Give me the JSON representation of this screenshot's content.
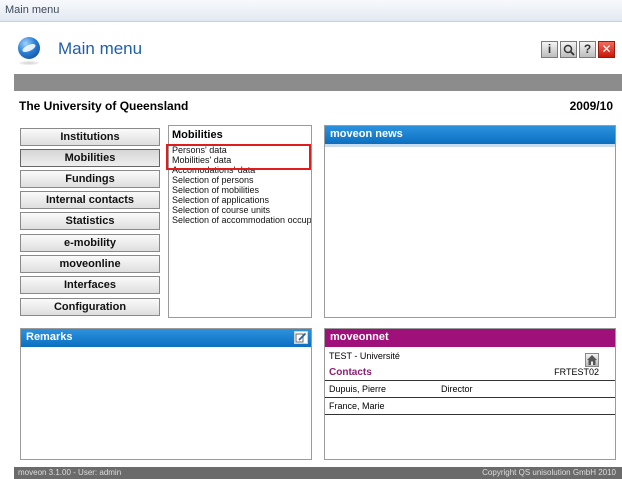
{
  "window": {
    "title": "Main menu"
  },
  "header": {
    "title": "Main menu"
  },
  "toolbar": {
    "info_label": "i",
    "help_label": "?",
    "close_label": "✕"
  },
  "org": {
    "name": "The University of Queensland",
    "year": "2009/10"
  },
  "nav": [
    {
      "label": "Institutions"
    },
    {
      "label": "Mobilities"
    },
    {
      "label": "Fundings"
    },
    {
      "label": "Internal contacts"
    },
    {
      "label": "Statistics"
    },
    {
      "label": "e-mobility"
    },
    {
      "label": "moveonline"
    },
    {
      "label": "Interfaces"
    },
    {
      "label": "Configuration"
    }
  ],
  "mobilities": {
    "title": "Mobilities",
    "items": [
      "Persons' data",
      "Mobilities' data",
      "Accomodations' data",
      "Selection of persons",
      "Selection of mobilities",
      "Selection of applications",
      "Selection of course units",
      "Selection of accommodation occupancy"
    ]
  },
  "news": {
    "title": "moveon news"
  },
  "remarks": {
    "title": "Remarks"
  },
  "moveonnet": {
    "title": "moveonnet",
    "institution": "TEST - Université",
    "contacts_label": "Contacts",
    "code": "FRTEST02",
    "contacts": [
      {
        "name": "Dupuis, Pierre",
        "role": "Director"
      },
      {
        "name": "France, Marie",
        "role": ""
      }
    ]
  },
  "status": {
    "left": "moveon 3.1.00 - User: admin",
    "right": "Copyright QS unisolution GmbH 2010"
  },
  "colors": {
    "header_title": "#1f5fa8",
    "panel_blue": "#0b6fc1",
    "panel_purple": "#a0107a",
    "highlight": "#e01d1d",
    "contacts_text": "#8a1f73"
  }
}
